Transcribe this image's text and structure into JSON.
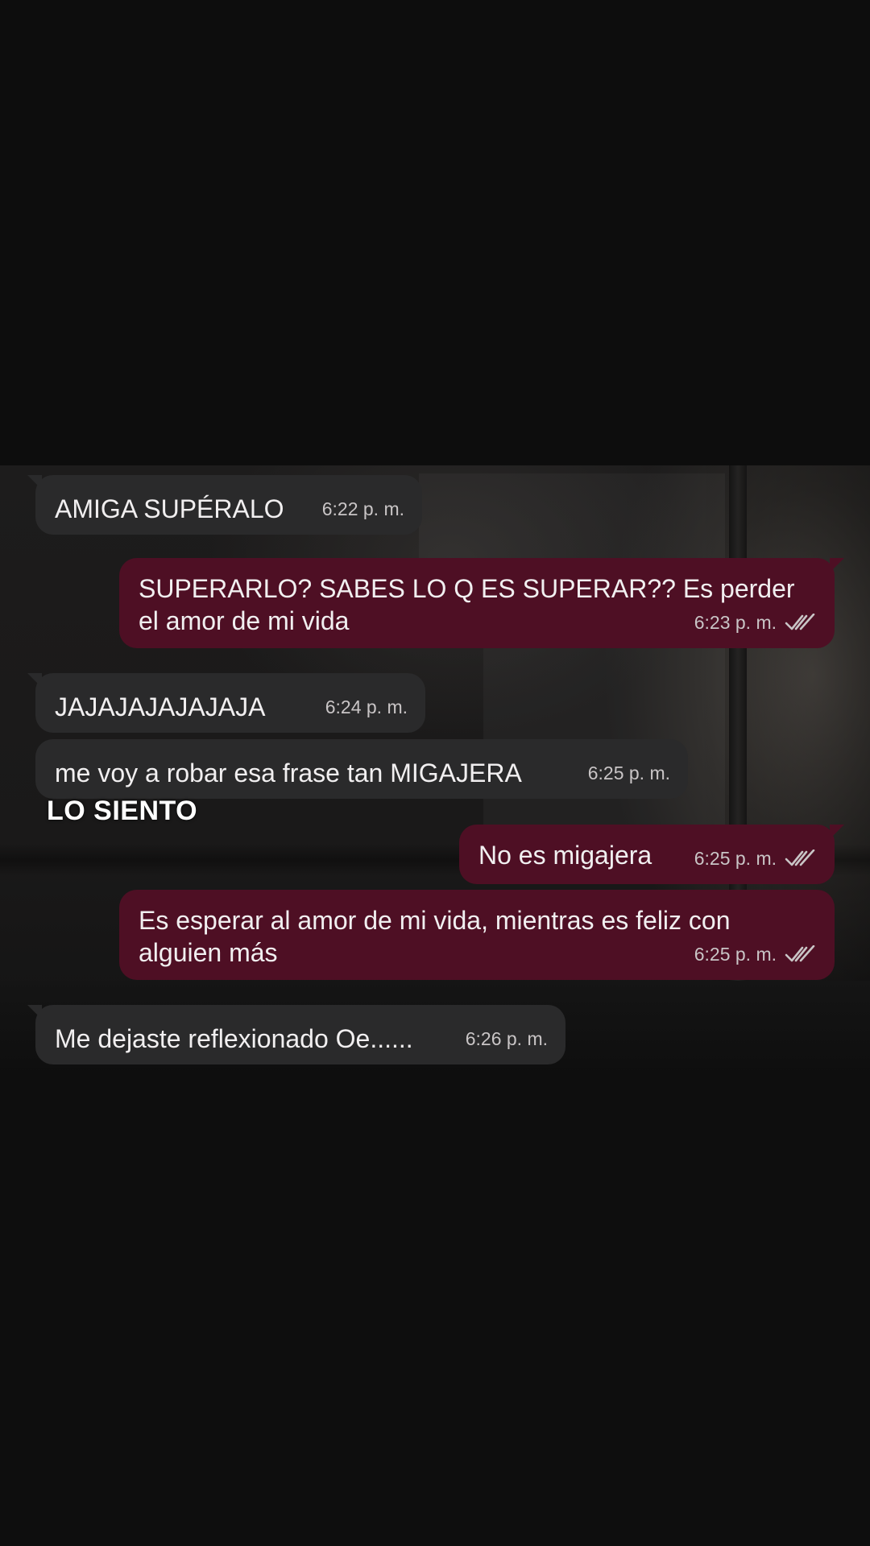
{
  "overlay": {
    "caption": "LO SIENTO"
  },
  "messages": [
    {
      "direction": "incoming",
      "text": "AMIGA SUPÉRALO",
      "time": "6:22 p. m."
    },
    {
      "direction": "outgoing",
      "text": "SUPERARLO? SABES LO Q ES SUPERAR?? Es perder el amor de mi vida",
      "time": "6:23 p. m.",
      "status": "read"
    },
    {
      "direction": "incoming",
      "text": "JAJAJAJAJAJAJA",
      "time": "6:24 p. m."
    },
    {
      "direction": "incoming",
      "text": "me voy a robar esa frase tan MIGAJERA",
      "time": "6:25 p. m."
    },
    {
      "direction": "outgoing",
      "text": "No es migajera",
      "time": "6:25 p. m.",
      "status": "read"
    },
    {
      "direction": "outgoing",
      "text": "Es esperar al amor de mi vida, mientras es feliz con alguien más",
      "time": "6:25 p. m.",
      "status": "read"
    },
    {
      "direction": "incoming",
      "text": "Me dejaste reflexionado Oe......",
      "time": "6:26 p. m."
    }
  ],
  "colors": {
    "incoming_bubble": "#2a2a2b",
    "outgoing_bubble": "#4e0f24",
    "background": "#0c0c0c"
  }
}
